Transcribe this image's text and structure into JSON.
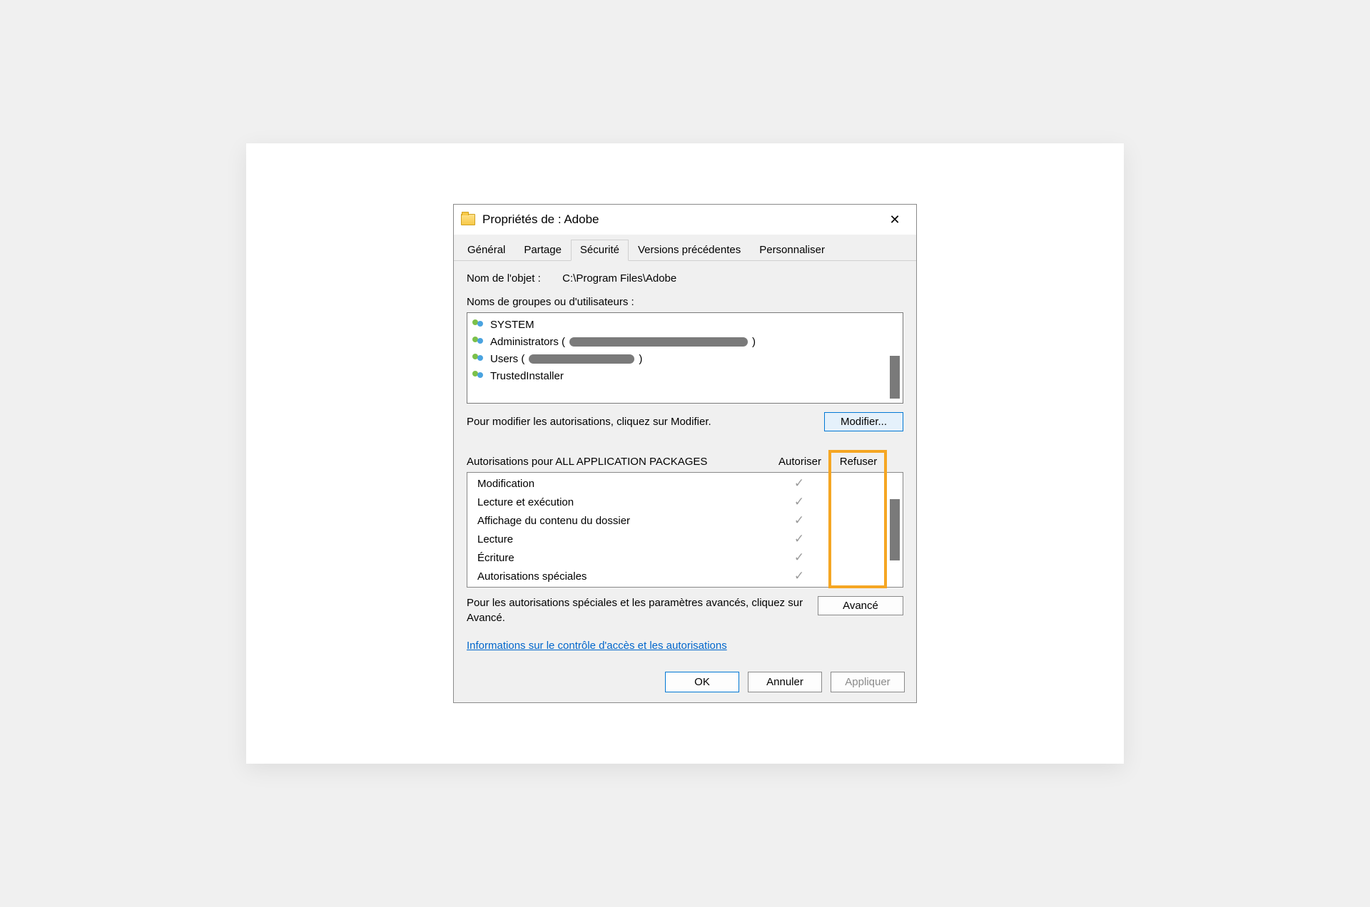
{
  "titlebar": {
    "title": "Propriétés de : Adobe"
  },
  "tabs": [
    {
      "label": "Général",
      "active": false
    },
    {
      "label": "Partage",
      "active": false
    },
    {
      "label": "Sécurité",
      "active": true
    },
    {
      "label": "Versions précédentes",
      "active": false
    },
    {
      "label": "Personnaliser",
      "active": false
    }
  ],
  "object": {
    "label": "Nom de l'objet :",
    "path": "C:\\Program Files\\Adobe"
  },
  "groups_label": "Noms de groupes ou d'utilisateurs :",
  "principals": [
    {
      "name": "SYSTEM",
      "redacted": false
    },
    {
      "name": "Administrators (",
      "redacted": true,
      "suffix": ")"
    },
    {
      "name": "Users (",
      "redacted": true,
      "suffix": ")"
    },
    {
      "name": "TrustedInstaller",
      "redacted": false
    }
  ],
  "modify_prompt": "Pour modifier les autorisations, cliquez sur Modifier.",
  "modify_button": "Modifier...",
  "perm_title": "Autorisations pour ALL APPLICATION PACKAGES",
  "columns": {
    "allow": "Autoriser",
    "deny": "Refuser"
  },
  "permissions": [
    {
      "name": "Modification",
      "allow": true,
      "deny": false
    },
    {
      "name": "Lecture et exécution",
      "allow": true,
      "deny": false
    },
    {
      "name": "Affichage du contenu du dossier",
      "allow": true,
      "deny": false
    },
    {
      "name": "Lecture",
      "allow": true,
      "deny": false
    },
    {
      "name": "Écriture",
      "allow": true,
      "deny": false
    },
    {
      "name": "Autorisations spéciales",
      "allow": true,
      "deny": false
    }
  ],
  "advanced_prompt": "Pour les autorisations spéciales et les paramètres avancés, cliquez sur Avancé.",
  "advanced_button": "Avancé",
  "help_link": "Informations sur le contrôle d'accès et les autorisations",
  "footer": {
    "ok": "OK",
    "cancel": "Annuler",
    "apply": "Appliquer"
  }
}
